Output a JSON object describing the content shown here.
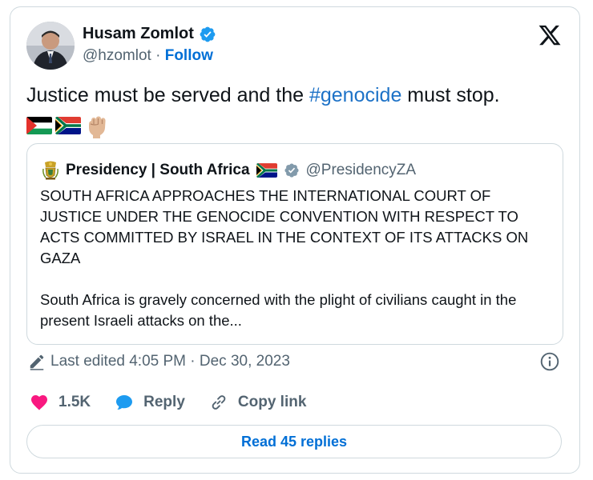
{
  "author": {
    "name": "Husam Zomlot",
    "handle": "@hzomlot",
    "separator": " · ",
    "follow_label": "Follow"
  },
  "tweet": {
    "text_before": "Justice must be served and the ",
    "hashtag": "#genocide",
    "text_after": " must stop."
  },
  "quote": {
    "name": "Presidency | South Africa",
    "handle": "@PresidencyZA",
    "paragraph1_lines": [
      "SOUTH AFRICA APPROACHES THE INTERNATIONAL COURT OF",
      "JUSTICE UNDER THE GENOCIDE CONVENTION WITH RESPECT TO",
      "ACTS COMMITTED BY ISRAEL IN THE CONTEXT OF ITS ATTACKS ON",
      "GAZA"
    ],
    "paragraph2_lines": [
      "South Africa is gravely concerned with the plight of civilians caught in the",
      "present Israeli attacks on the..."
    ]
  },
  "edited": {
    "label": "Last edited 4:05 PM · Dec 30, 2023"
  },
  "actions": {
    "likes": "1.5K",
    "reply_label": "Reply",
    "copy_label": "Copy link"
  },
  "read_replies_label": "Read 45 replies",
  "colors": {
    "link_blue": "#006fd6",
    "verified_blue": "#1d9bf0",
    "like_pink": "#f91880",
    "reply_blue": "#1d9bf0",
    "muted_text": "#536471",
    "border": "#cfd9de"
  },
  "icons": [
    "verified-badge-icon",
    "x-logo-icon",
    "palestine-flag-icon",
    "south-africa-flag-icon",
    "raised-fist-icon",
    "coat-of-arms-icon",
    "gray-verified-badge-icon",
    "pencil-icon",
    "info-icon",
    "heart-icon",
    "speech-bubble-icon",
    "link-icon"
  ]
}
